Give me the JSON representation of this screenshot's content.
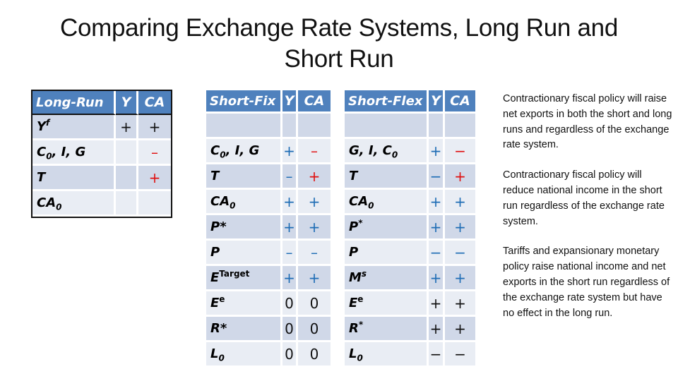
{
  "slide": {
    "title": "Comparing Exchange Rate Systems, Long Run and Short Run"
  },
  "colors": {
    "header_bg": "#4f81bd",
    "row_dark": "#d0d8e8",
    "row_light": "#e9edf4",
    "sign_blue": "#1f6db5",
    "sign_red": "#e01010",
    "sign_black": "#111111"
  },
  "long_run": {
    "header": [
      "Long-Run",
      "Y",
      "CA"
    ],
    "rows": [
      {
        "label": "Y",
        "sup": "f",
        "sub": "",
        "rest": "",
        "y": "+",
        "ca": "+",
        "y_color": "blk",
        "ca_color": "blk"
      },
      {
        "label": "C",
        "sup": "",
        "sub": "0",
        "rest": ", I, G",
        "y": "",
        "ca": "–",
        "y_color": "blk",
        "ca_color": "red"
      },
      {
        "label": "T",
        "sup": "",
        "sub": "",
        "rest": "",
        "y": "",
        "ca": "+",
        "y_color": "blk",
        "ca_color": "red"
      },
      {
        "label": "CA",
        "sup": "",
        "sub": "0",
        "rest": "",
        "y": "",
        "ca": "",
        "y_color": "blk",
        "ca_color": "blk"
      }
    ]
  },
  "short_fix": {
    "header": [
      "Short-Fix",
      "Y",
      "CA"
    ],
    "rows": [
      {
        "label": "",
        "sup": "",
        "sub": "",
        "rest": "",
        "y": "",
        "ca": "",
        "y_color": "blk",
        "ca_color": "blk"
      },
      {
        "label": "C",
        "sup": "",
        "sub": "0",
        "rest": ", I, G",
        "y": "+",
        "ca": "–",
        "y_color": "blu",
        "ca_color": "red"
      },
      {
        "label": "T",
        "sup": "",
        "sub": "",
        "rest": "",
        "y": "–",
        "ca": "+",
        "y_color": "blu",
        "ca_color": "red"
      },
      {
        "label": "CA",
        "sup": "",
        "sub": "0",
        "rest": "",
        "y": "+",
        "ca": "+",
        "y_color": "blu",
        "ca_color": "blu"
      },
      {
        "label": "P*",
        "sup": "",
        "sub": "",
        "rest": "",
        "y": "+",
        "ca": "+",
        "y_color": "blu",
        "ca_color": "blu"
      },
      {
        "label": "P",
        "sup": "",
        "sub": "",
        "rest": "",
        "y": "–",
        "ca": "–",
        "y_color": "blu",
        "ca_color": "blu"
      },
      {
        "label": "E",
        "sup": "Target",
        "sub": "",
        "rest": "",
        "y": "+",
        "ca": "+",
        "y_color": "blu",
        "ca_color": "blu"
      },
      {
        "label": "E",
        "sup": "e",
        "sub": "",
        "rest": "",
        "y": "0",
        "ca": "0",
        "y_color": "blk",
        "ca_color": "blk"
      },
      {
        "label": "R*",
        "sup": "",
        "sub": "",
        "rest": "",
        "y": "0",
        "ca": "0",
        "y_color": "blk",
        "ca_color": "blk"
      },
      {
        "label": "L",
        "sup": "",
        "sub": "0",
        "rest": "",
        "y": "0",
        "ca": "0",
        "y_color": "blk",
        "ca_color": "blk"
      }
    ]
  },
  "short_flex": {
    "header": [
      "Short-Flex",
      "Y",
      "CA"
    ],
    "rows": [
      {
        "label": "",
        "sup": "",
        "sub": "",
        "rest": "",
        "y": "",
        "ca": "",
        "y_color": "blk",
        "ca_color": "blk"
      },
      {
        "label": "G, I, C",
        "sup": "",
        "sub": "0",
        "rest": "",
        "y": "+",
        "ca": "−",
        "y_color": "blu",
        "ca_color": "red"
      },
      {
        "label": "T",
        "sup": "",
        "sub": "",
        "rest": "",
        "y": "−",
        "ca": "+",
        "y_color": "blu",
        "ca_color": "red"
      },
      {
        "label": "CA",
        "sup": "",
        "sub": "0",
        "rest": "",
        "y": "+",
        "ca": "+",
        "y_color": "blu",
        "ca_color": "blu"
      },
      {
        "label": "P",
        "sup": "*",
        "sub": "",
        "rest": "",
        "y": "+",
        "ca": "+",
        "y_color": "blu",
        "ca_color": "blu"
      },
      {
        "label": "P",
        "sup": "",
        "sub": "",
        "rest": "",
        "y": "−",
        "ca": "−",
        "y_color": "blu",
        "ca_color": "blu"
      },
      {
        "label": "M",
        "sup": "s",
        "sub": "",
        "rest": "",
        "y": "+",
        "ca": "+",
        "y_color": "blu",
        "ca_color": "blu"
      },
      {
        "label": "E",
        "sup": "e",
        "sub": "",
        "rest": "",
        "y": "+",
        "ca": "+",
        "y_color": "blk",
        "ca_color": "blk"
      },
      {
        "label": "R",
        "sup": "*",
        "sub": "",
        "rest": "",
        "y": "+",
        "ca": "+",
        "y_color": "blk",
        "ca_color": "blk"
      },
      {
        "label": "L",
        "sup": "",
        "sub": "0",
        "rest": "",
        "y": "−",
        "ca": "−",
        "y_color": "blk",
        "ca_color": "blk"
      }
    ]
  },
  "notes": [
    "Contractionary fiscal policy will raise net exports in both the short and long runs and regardless of the exchange rate system.",
    "Contractionary fiscal policy will reduce national income in the short run regardless of the exchange rate system.",
    "Tariffs and expansionary monetary policy raise national income and net exports in the short run regardless of the exchange rate system but have no effect in the long run."
  ]
}
